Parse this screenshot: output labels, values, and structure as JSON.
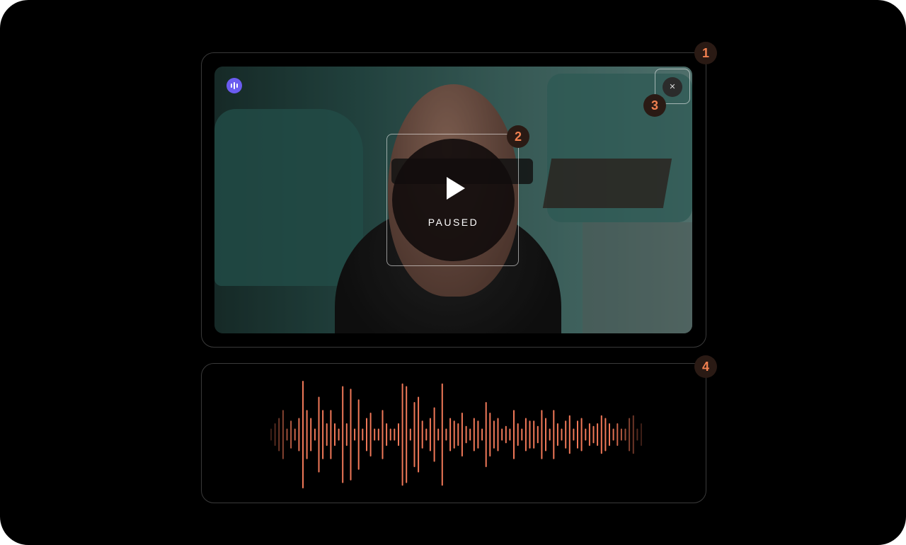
{
  "player": {
    "status_label": "PAUSED",
    "app_badge_icon": "audio-waves-icon",
    "play_icon": "play-icon",
    "collapse_icon": "collapse-icon"
  },
  "markers": [
    "1",
    "2",
    "3",
    "4"
  ],
  "colors": {
    "background": "#000000",
    "accent": "#f08050",
    "badge": "#6b5cf0",
    "waveform": "#f07858"
  },
  "waveform": {
    "amplitudes": [
      0.1,
      0.2,
      0.3,
      0.45,
      0.1,
      0.25,
      0.1,
      0.3,
      1.0,
      0.45,
      0.3,
      0.1,
      0.7,
      0.45,
      0.2,
      0.45,
      0.2,
      0.1,
      0.9,
      0.2,
      0.85,
      0.1,
      0.65,
      0.1,
      0.3,
      0.4,
      0.1,
      0.1,
      0.45,
      0.2,
      0.1,
      0.1,
      0.2,
      0.95,
      0.9,
      0.1,
      0.6,
      0.7,
      0.25,
      0.1,
      0.3,
      0.5,
      0.1,
      0.95,
      0.1,
      0.3,
      0.25,
      0.2,
      0.4,
      0.15,
      0.1,
      0.3,
      0.25,
      0.1,
      0.6,
      0.4,
      0.25,
      0.3,
      0.1,
      0.15,
      0.1,
      0.45,
      0.2,
      0.1,
      0.3,
      0.25,
      0.25,
      0.15,
      0.45,
      0.3,
      0.1,
      0.45,
      0.2,
      0.1,
      0.25,
      0.35,
      0.1,
      0.25,
      0.3,
      0.1,
      0.2,
      0.15,
      0.2,
      0.35,
      0.3,
      0.2,
      0.1,
      0.2,
      0.1,
      0.1,
      0.3,
      0.35,
      0.1,
      0.2
    ]
  }
}
